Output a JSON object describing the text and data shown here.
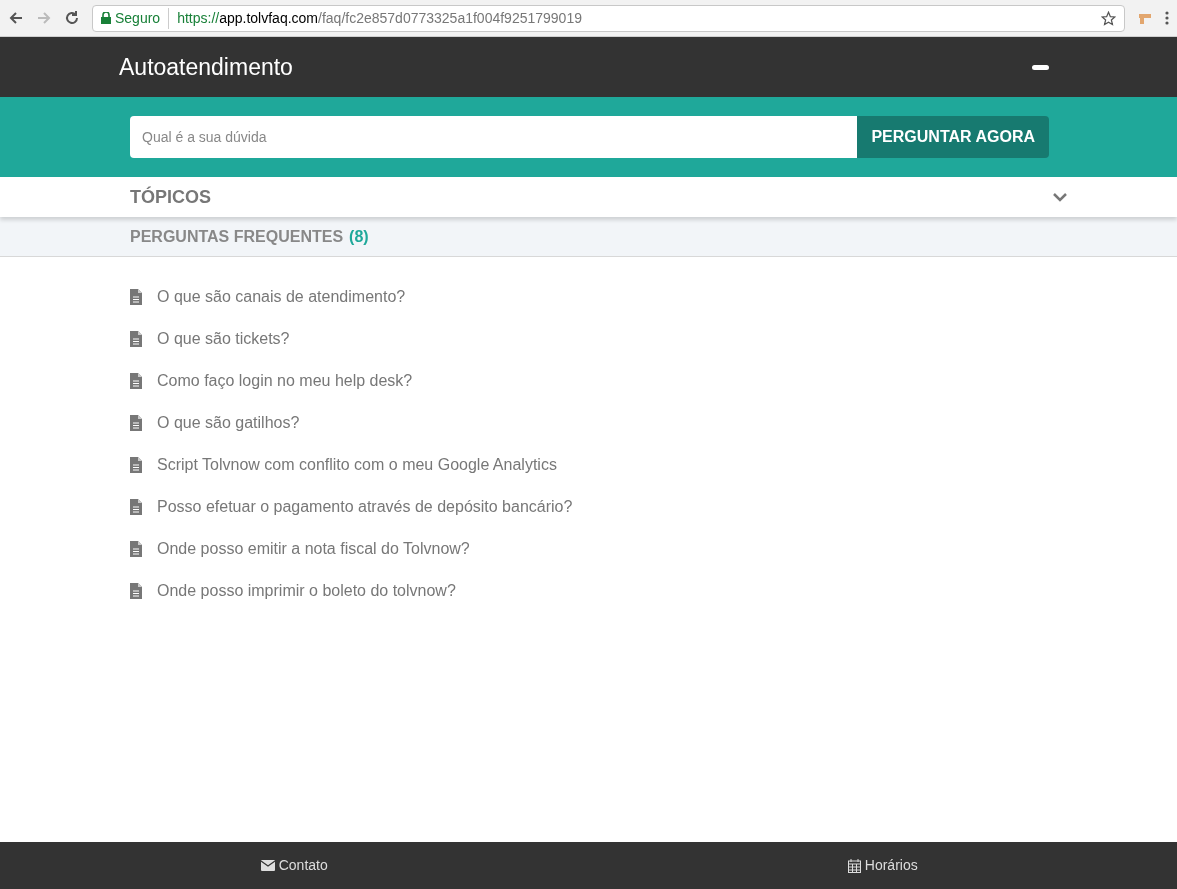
{
  "browser": {
    "security_label": "Seguro",
    "url": {
      "scheme": "https://",
      "host": "app.tolvfaq.com",
      "path": "/faq/fc2e857d0773325a1f004f9251799019"
    }
  },
  "header": {
    "title": "Autoatendimento"
  },
  "search": {
    "placeholder": "Qual é a sua dúvida",
    "button": "PERGUNTAR AGORA"
  },
  "topics": {
    "label": "TÓPICOS",
    "expanded": false
  },
  "faq": {
    "title": "PERGUNTAS FREQUENTES",
    "count": "(8)",
    "items": [
      "O que são canais de atendimento?",
      "O que são tickets?",
      "Como faço login no meu help desk?",
      "O que são gatilhos?",
      "Script Tolvnow com conflito com o meu Google Analytics",
      "Posso efetuar o pagamento através de depósito bancário?",
      "Onde posso emitir a nota fiscal do Tolvnow?",
      "Onde posso imprimir o boleto do tolvnow?"
    ]
  },
  "footer": [
    {
      "kind": "mail",
      "label": "Contato"
    },
    {
      "kind": "calendar",
      "label": "Horários"
    }
  ]
}
